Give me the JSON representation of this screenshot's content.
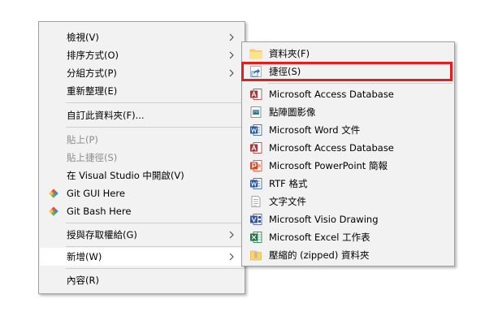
{
  "context_menu": {
    "items": [
      {
        "label": "檢視(V)"
      },
      {
        "label": "排序方式(O)"
      },
      {
        "label": "分組方式(P)"
      },
      {
        "label": "重新整理(E)"
      },
      {
        "label": "自訂此資料夾(F)..."
      },
      {
        "label": "貼上(P)"
      },
      {
        "label": "貼上捷徑(S)"
      },
      {
        "label": "在 Visual Studio 中開啟(V)"
      },
      {
        "label": "Git GUI Here"
      },
      {
        "label": "Git Bash Here"
      },
      {
        "label": "授與存取權給(G)"
      },
      {
        "label": "新增(W)"
      },
      {
        "label": "內容(R)"
      }
    ]
  },
  "new_submenu": {
    "items": [
      {
        "label": "資料夾(F)",
        "icon": "folder-icon"
      },
      {
        "label": "捷徑(S)",
        "icon": "shortcut-icon"
      },
      {
        "label": "Microsoft Access Database",
        "icon": "access-icon"
      },
      {
        "label": "點陣圖影像",
        "icon": "bitmap-icon"
      },
      {
        "label": "Microsoft Word 文件",
        "icon": "word-icon"
      },
      {
        "label": "Microsoft Access Database",
        "icon": "access-icon"
      },
      {
        "label": "Microsoft PowerPoint 簡報",
        "icon": "powerpoint-icon"
      },
      {
        "label": "RTF 格式",
        "icon": "rtf-icon"
      },
      {
        "label": "文字文件",
        "icon": "text-document-icon"
      },
      {
        "label": "Microsoft Visio Drawing",
        "icon": "visio-icon"
      },
      {
        "label": "Microsoft Excel 工作表",
        "icon": "excel-icon"
      },
      {
        "label": "壓縮的 (zipped) 資料夾",
        "icon": "zip-folder-icon"
      }
    ],
    "highlighted_item": "捷徑(S)"
  },
  "colors": {
    "highlight_border": "#e0201e",
    "word": "#2b579a",
    "excel": "#217346",
    "powerpoint": "#d24726",
    "access": "#a4373a",
    "visio": "#3955a3",
    "folder": "#ffd35c"
  }
}
